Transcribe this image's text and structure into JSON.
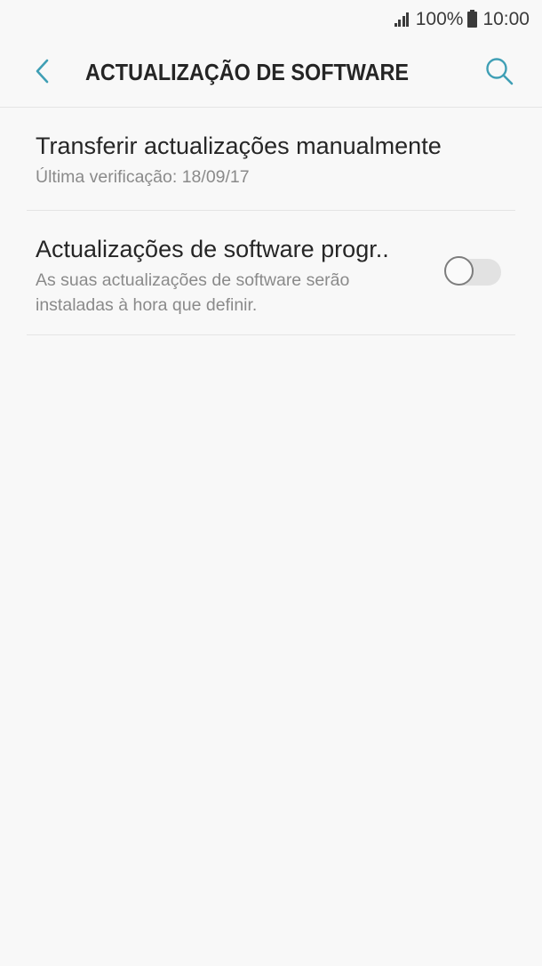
{
  "status_bar": {
    "battery": "100%",
    "time": "10:00",
    "icons": [
      "signal-icon",
      "battery-icon"
    ]
  },
  "header": {
    "title": "ACTUALIZAÇÃO DE SOFTWARE",
    "back_icon": "chevron-left-icon",
    "search_icon": "search-icon"
  },
  "settings": [
    {
      "title": "Transferir actualizações manualmente",
      "subtitle": "Última verificação: 18/09/17"
    },
    {
      "title": "Actualizações de software progr..",
      "subtitle": "As suas actualizações de software serão instaladas à hora que definir.",
      "toggle_on": false
    }
  ],
  "colors": {
    "accent": "#3f9fb5",
    "background": "#f8f8f8",
    "title_text": "#252525",
    "subtitle_text": "#8a8a8a"
  }
}
